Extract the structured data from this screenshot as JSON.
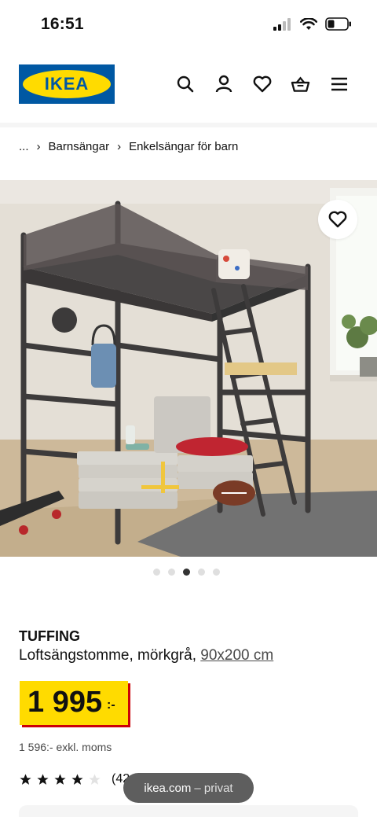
{
  "status": {
    "time": "16:51"
  },
  "brand": {
    "logo_text": "IKEA",
    "blue": "#0058a3",
    "yellow": "#ffdb00"
  },
  "nav": {
    "icons": [
      "search-icon",
      "account-icon",
      "heart-icon",
      "basket-icon",
      "menu-icon"
    ]
  },
  "breadcrumb": {
    "ellipsis": "...",
    "items": [
      "Barnsängar",
      "Enkelsängar för barn"
    ]
  },
  "gallery": {
    "image_count": 5,
    "active_index": 2
  },
  "product": {
    "name": "TUFFING",
    "description": "Loftsängstomme, mörkgrå,",
    "size": "90x200 cm",
    "price": "1 995",
    "price_suffix": ":-",
    "price_ex_vat": "1 596:- exkl. moms",
    "rating_stars": 4,
    "rating_count": "(42"
  },
  "browser": {
    "domain": "ikea.com",
    "mode": "– privat"
  },
  "colors": {
    "price_shadow": "#cc0008"
  }
}
